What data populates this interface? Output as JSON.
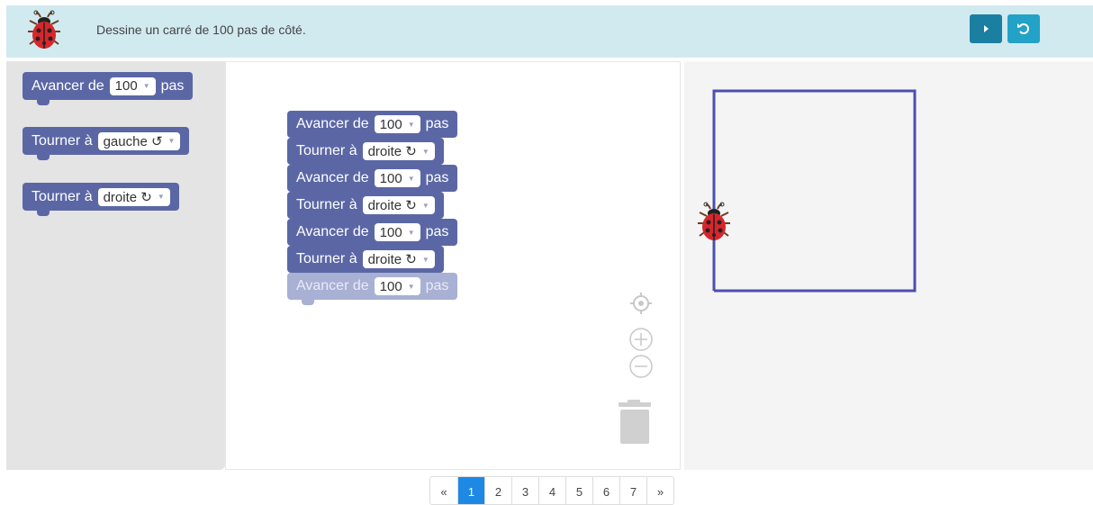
{
  "header": {
    "task": "Dessine un carré de 100 pas de côté."
  },
  "toolbox": {
    "blocks": [
      {
        "keyword": "Avancer de",
        "value": "100",
        "suffix": "pas"
      },
      {
        "keyword": "Tourner à",
        "value": "gauche ↺"
      },
      {
        "keyword": "Tourner à",
        "value": "droite ↻"
      }
    ]
  },
  "program": {
    "blocks": [
      {
        "keyword": "Avancer de",
        "value": "100",
        "suffix": "pas"
      },
      {
        "keyword": "Tourner à",
        "value": "droite ↻"
      },
      {
        "keyword": "Avancer de",
        "value": "100",
        "suffix": "pas"
      },
      {
        "keyword": "Tourner à",
        "value": "droite ↻"
      },
      {
        "keyword": "Avancer de",
        "value": "100",
        "suffix": "pas"
      },
      {
        "keyword": "Tourner à",
        "value": "droite ↻"
      },
      {
        "keyword": "Avancer de",
        "value": "100",
        "suffix": "pas"
      }
    ]
  },
  "pagination": {
    "prev": "«",
    "pages": [
      "1",
      "2",
      "3",
      "4",
      "5",
      "6",
      "7"
    ],
    "current": "1",
    "next": "»"
  },
  "colors": {
    "block": "#5b67a5",
    "block_ghost": "#a8b0d4",
    "header_bg": "#d1eaf0",
    "run_button": "#1a7fa1",
    "reset_button": "#23a2c8",
    "path": "#4b4fb0",
    "page_active": "#1e88e5"
  },
  "icons": {
    "mascot": "ladybug-icon",
    "run": "play-icon",
    "reset": "undo-icon",
    "recenter": "crosshair-icon",
    "zoom_in": "zoom-in-icon",
    "zoom_out": "zoom-out-icon",
    "trash": "trash-icon"
  }
}
